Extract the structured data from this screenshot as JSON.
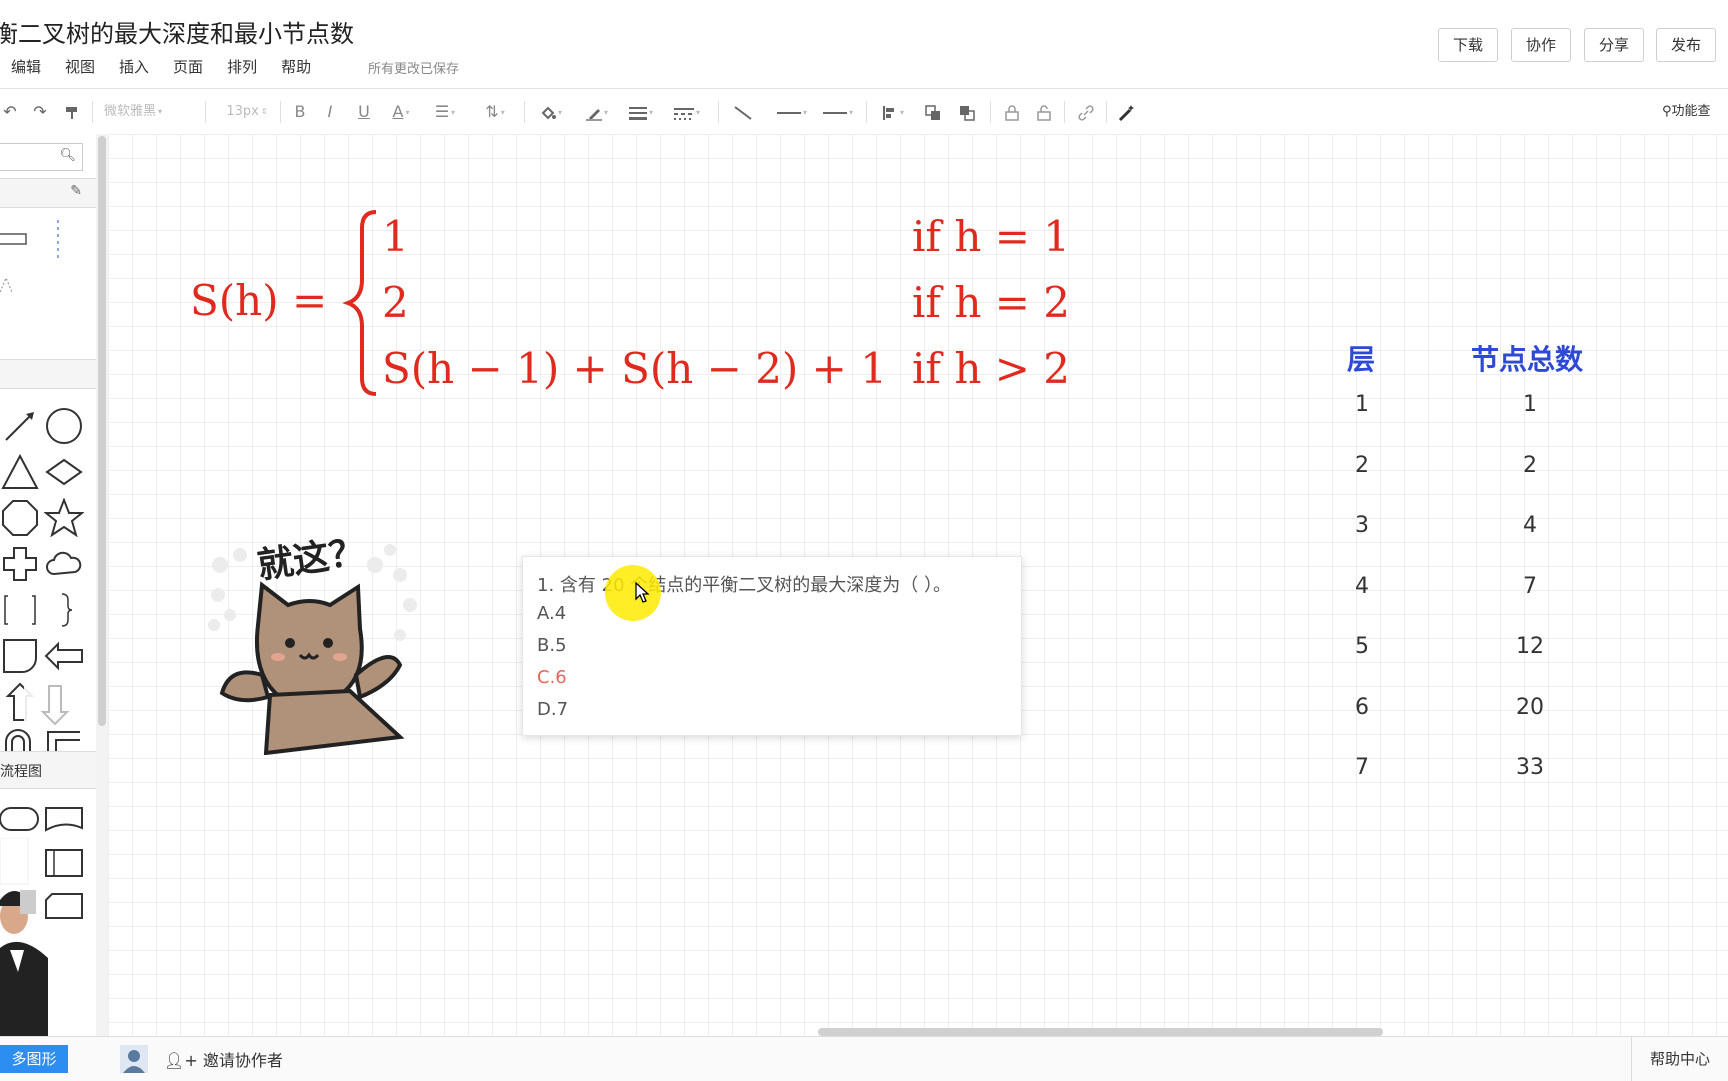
{
  "header": {
    "title": "衡二叉树的最大深度和最小节点数",
    "menu": [
      "编辑",
      "视图",
      "插入",
      "页面",
      "排列",
      "帮助"
    ],
    "save_status": "所有更改已保存",
    "buttons": {
      "download": "下载",
      "collaborate": "协作",
      "share": "分享",
      "publish": "发布"
    }
  },
  "toolbar": {
    "font_family": "微软雅黑",
    "font_size": "13px",
    "bold": "B",
    "italic": "I",
    "underline": "U",
    "font_color": "A",
    "feature_search": "功能查"
  },
  "sidebar": {
    "section_label": "流程图"
  },
  "formula": {
    "lhs": "S(h) =",
    "cases": [
      {
        "value": "1",
        "condition": "if h = 1"
      },
      {
        "value": "2",
        "condition": "if h = 2"
      },
      {
        "value": "S(h − 1) + S(h − 2) + 1",
        "condition": "if h > 2"
      }
    ]
  },
  "question": {
    "text": "1. 含有 20 个结点的平衡二叉树的最大深度为（ ）。",
    "options": [
      "A.4",
      "B.5",
      "C.6",
      "D.7"
    ],
    "highlighted_option": 2
  },
  "table": {
    "headers": [
      "层",
      "节点总数"
    ],
    "rows": [
      [
        "1",
        "1"
      ],
      [
        "2",
        "2"
      ],
      [
        "3",
        "4"
      ],
      [
        "4",
        "7"
      ],
      [
        "5",
        "12"
      ],
      [
        "6",
        "20"
      ],
      [
        "7",
        "33"
      ]
    ]
  },
  "sticker": {
    "text": "就这？"
  },
  "statusbar": {
    "more_shapes": "多图形",
    "invite": "邀请协作者",
    "help_center": "帮助中心"
  },
  "colors": {
    "formula": "#e02a1f",
    "table_header": "#2d49d6",
    "correct_option": "#e8655b",
    "primary_button": "#2b8ef0"
  }
}
